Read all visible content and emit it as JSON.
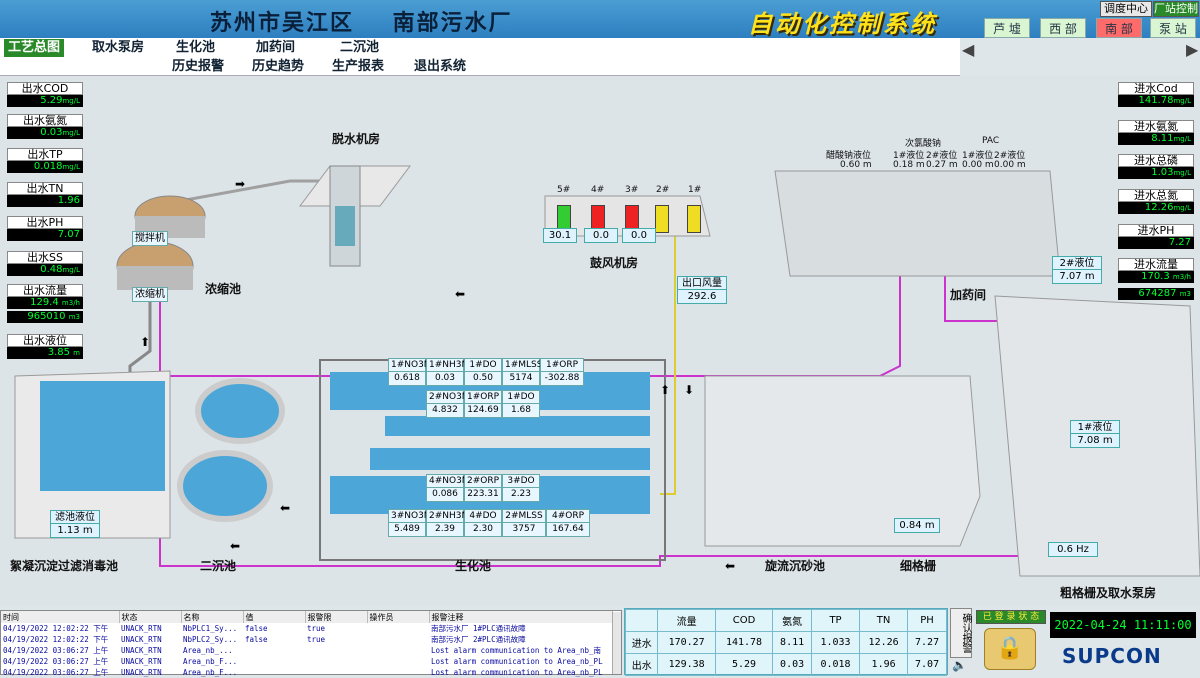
{
  "header": {
    "plant_title": "苏州市吴江区    南部污水厂",
    "system_title": "自动化控制系统",
    "dispatch_btn": "调度中心",
    "plant_control_btn": "厂站控制",
    "areas": [
      "芦 墟",
      "西 部",
      "南 部",
      "泵 站"
    ]
  },
  "nav": [
    "工艺总图",
    "取水泵房",
    "生化池",
    "加药间",
    "二沉池",
    "历史报警",
    "历史趋势",
    "生产报表",
    "退出系统"
  ],
  "outlet_panel": [
    {
      "label": "出水COD",
      "value": "5.29",
      "unit": "mg/L"
    },
    {
      "label": "出水氨氮",
      "value": "0.03",
      "unit": "mg/L"
    },
    {
      "label": "出水TP",
      "value": "0.018",
      "unit": "mg/L"
    },
    {
      "label": "出水TN",
      "value": "1.96",
      "unit": ""
    },
    {
      "label": "出水PH",
      "value": "7.07",
      "unit": ""
    },
    {
      "label": "出水SS",
      "value": "0.48",
      "unit": "mg/L"
    },
    {
      "label": "出水流量",
      "value": "129.4",
      "unit": "m3/h"
    },
    {
      "label": "",
      "value": "965010",
      "unit": "m3"
    },
    {
      "label": "出水液位",
      "value": "3.85",
      "unit": "m"
    }
  ],
  "inlet_panel": [
    {
      "label": "进水Cod",
      "value": "141.78",
      "unit": "mg/L"
    },
    {
      "label": "进水氨氮",
      "value": "8.11",
      "unit": "mg/L"
    },
    {
      "label": "进水总磷",
      "value": "1.03",
      "unit": "mg/L"
    },
    {
      "label": "进水总氮",
      "value": "12.26",
      "unit": "mg/L"
    },
    {
      "label": "进水PH",
      "value": "7.27",
      "unit": ""
    },
    {
      "label": "进水流量",
      "value": "170.3",
      "unit": "m3/h"
    },
    {
      "label": "",
      "value": "674287",
      "unit": "m3"
    }
  ],
  "sections": {
    "dewatering": "脱水机房",
    "thickener": "浓缩池",
    "mixer": "搅拌机",
    "concentrator": "浓缩机",
    "blower": "鼓风机房",
    "dosing": "加药间",
    "coag": "絮凝沉淀过滤消毒池",
    "secondary": "二沉池",
    "bio": "生化池",
    "grit": "旋流沉砂池",
    "fine_screen": "细格栅",
    "coarse": "粗格栅及取水泵房"
  },
  "blowers": {
    "labels": [
      "5#",
      "4#",
      "3#",
      "2#",
      "1#"
    ],
    "colors": [
      "#33cc33",
      "#ee2222",
      "#ee2222",
      "#eedd22",
      "#eedd22"
    ],
    "values": [
      "30.1",
      "0.0",
      "0.0"
    ],
    "outlet_air_label": "出口风量",
    "outlet_air_value": "292.6"
  },
  "dosing": {
    "sodium_acetate": "醋酸钠液位",
    "sodium_acetate_val": "0.60 m",
    "hypochlorite": "次氯酸钠",
    "hypo_1": "1#液位",
    "hypo_2": "2#液位",
    "hypo_1_val": "0.18 m",
    "hypo_2_val": "0.27 m",
    "pac": "PAC",
    "pac_1": "1#液位",
    "pac_2": "2#液位",
    "pac_1_val": "0.00 m",
    "pac_2_val": "0.00 m"
  },
  "bio_top": {
    "headers": [
      "1#NO3N",
      "1#NH3N",
      "1#DO",
      "1#MLSS",
      "1#ORP"
    ],
    "values": [
      "0.618",
      "0.03",
      "0.50",
      "5174",
      "-302.88"
    ]
  },
  "bio_mid": {
    "headers": [
      "2#NO3N",
      "1#ORP",
      "1#DO"
    ],
    "values": [
      "4.832",
      "124.69",
      "1.68"
    ]
  },
  "bio_mid2": {
    "headers": [
      "4#NO3N",
      "2#ORP",
      "3#DO"
    ],
    "values": [
      "0.086",
      "223.31",
      "2.23"
    ]
  },
  "bio_bottom": {
    "headers": [
      "3#NO3N",
      "2#NH3N",
      "4#DO",
      "2#MLSS",
      "4#ORP"
    ],
    "values": [
      "5.489",
      "2.39",
      "2.30",
      "3757",
      "167.64"
    ]
  },
  "filter_level_label": "滤池液位",
  "filter_level_value": "1.13",
  "filter_level_unit": "m",
  "fine_screen_value": "0.84",
  "fine_screen_unit": "m",
  "level2_label": "2#液位",
  "level2_value": "7.07",
  "level1_label": "1#液位",
  "level1_value": "7.08",
  "level_unit": "m",
  "freq_value": "0.6",
  "freq_unit": "Hz",
  "alarm": {
    "headers": [
      "时间",
      "状态",
      "名称",
      "值",
      "报警限",
      "操作员",
      "报警注释"
    ],
    "rows": [
      [
        "04/19/2022 12:02:22 下午",
        "UNACK_RTN",
        "NbPLC1_Sy...",
        "false",
        "true",
        "",
        "南部污水厂 1#PLC通讯故障"
      ],
      [
        "04/19/2022 12:02:22 下午",
        "UNACK_RTN",
        "NbPLC2_Sy...",
        "false",
        "true",
        "",
        "南部污水厂 2#PLC通讯故障"
      ],
      [
        "04/19/2022 03:06:27 上午",
        "UNACK_RTN",
        "Area_nb_...",
        "",
        "",
        "",
        "Lost alarm communication to Area_nb_南"
      ],
      [
        "04/19/2022 03:06:27 上午",
        "UNACK_RTN",
        "Area_nb_F...",
        "",
        "",
        "",
        "Lost alarm communication to Area_nb_PL"
      ],
      [
        "04/19/2022 03:06:27 上午",
        "UNACK_RTN",
        "Area_nb_F...",
        "",
        "",
        "",
        "Lost alarm communication to Area_nb_PL"
      ]
    ]
  },
  "quality": {
    "headers": [
      "",
      "流量",
      "COD",
      "氨氮",
      "TP",
      "TN",
      "PH"
    ],
    "rows": [
      [
        "进水",
        "170.27",
        "141.78",
        "8.11",
        "1.033",
        "12.26",
        "7.27"
      ],
      [
        "出水",
        "129.38",
        "5.29",
        "0.03",
        "0.018",
        "1.96",
        "7.07"
      ]
    ]
  },
  "ack_label": "确认报警",
  "login_status": "已 登 录 状 态",
  "datetime": "2022-04-24  11:11:00",
  "brand": "SUPCON",
  "colors": {
    "pipe_magenta": "#cc33cc",
    "pipe_yellow": "#ddcc33",
    "water": "#4da6d8",
    "header_blue": "#3a8fcc"
  }
}
